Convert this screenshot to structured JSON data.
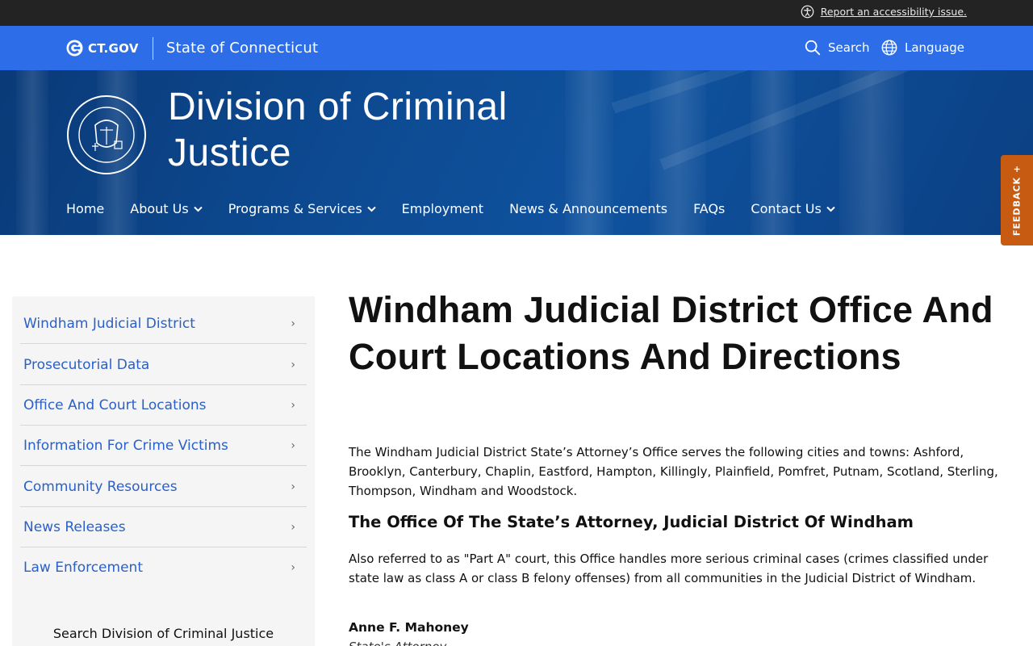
{
  "utility": {
    "accessibility_link": "Report an accessibility issue."
  },
  "govbar": {
    "logo_text": "CT.GOV",
    "state_name": "State of Connecticut",
    "search_label": "Search",
    "language_label": "Language"
  },
  "hero": {
    "title_line1": "Division of Criminal",
    "title_line2": "Justice",
    "nav": [
      {
        "label": "Home",
        "has_dropdown": false
      },
      {
        "label": "About Us",
        "has_dropdown": true
      },
      {
        "label": "Programs & Services",
        "has_dropdown": true
      },
      {
        "label": "Employment",
        "has_dropdown": false
      },
      {
        "label": "News & Announcements",
        "has_dropdown": false
      },
      {
        "label": "FAQs",
        "has_dropdown": false
      },
      {
        "label": "Contact Us",
        "has_dropdown": true
      }
    ]
  },
  "feedback": {
    "label": "FEEDBACK +"
  },
  "sidebar": {
    "items": [
      {
        "label": "Windham Judicial District"
      },
      {
        "label": "Prosecutorial Data"
      },
      {
        "label": "Office And Court Locations"
      },
      {
        "label": "Information For Crime Victims"
      },
      {
        "label": "Community Resources"
      },
      {
        "label": "News Releases"
      },
      {
        "label": "Law Enforcement"
      }
    ],
    "search_heading": "Search Division of Criminal Justice"
  },
  "main": {
    "title": "Windham Judicial District Office And Court Locations And Directions",
    "intro": "The Windham Judicial District State’s Attorney’s Office serves the following cities and towns: Ashford, Brooklyn, Canterbury, Chaplin, Eastford, Hampton, Killingly, Plainfield, Pomfret, Putnam, Scotland, Sterling, Thompson, Windham and Woodstock.",
    "section_heading": "The Office Of The State’s Attorney, Judicial District Of Windham",
    "section_text": "Also referred to as \"Part A\" court, this Office handles more serious criminal cases (crimes classified under state law as class A or class B felony offenses) from all communities in the Judicial District of Windham.",
    "contact_name": "Anne F. Mahoney",
    "contact_role": "State's Attorney"
  },
  "colors": {
    "utility_bg": "#232323",
    "govbar_bg": "#2d6ee8",
    "hero_bg": "#0d4a92",
    "link_blue": "#2a60c8",
    "feedback_bg": "#c75b12",
    "sidebar_bg": "#f5f5f5"
  },
  "icons": [
    "accessibility-icon",
    "ct-logo-icon",
    "search-icon",
    "globe-icon",
    "seal-icon",
    "chevron-down-icon",
    "chevron-right-icon"
  ]
}
